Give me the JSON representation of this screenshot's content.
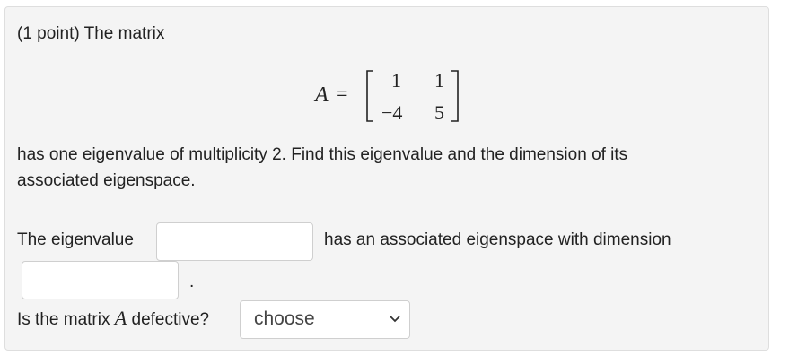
{
  "problem": {
    "intro": "(1 point) The matrix",
    "matrix_var": "A",
    "equals": "=",
    "matrix": [
      [
        "1",
        "1"
      ],
      [
        "−4",
        "5"
      ]
    ],
    "description_line1": "has one eigenvalue of multiplicity 2. Find this eigenvalue and the dimension of its",
    "description_line2": "associated eigenspace."
  },
  "answer": {
    "eigenvalue_label": "The eigenvalue",
    "eigenvalue_value": "",
    "eigenspace_label": "has an associated eigenspace with dimension",
    "dimension_value": "",
    "period": ".",
    "defective_prefix": "Is the matrix",
    "defective_var": "A",
    "defective_suffix": "defective?",
    "defective_selected": "choose"
  },
  "icons": {
    "select_arrow": "chevron-down-icon"
  }
}
